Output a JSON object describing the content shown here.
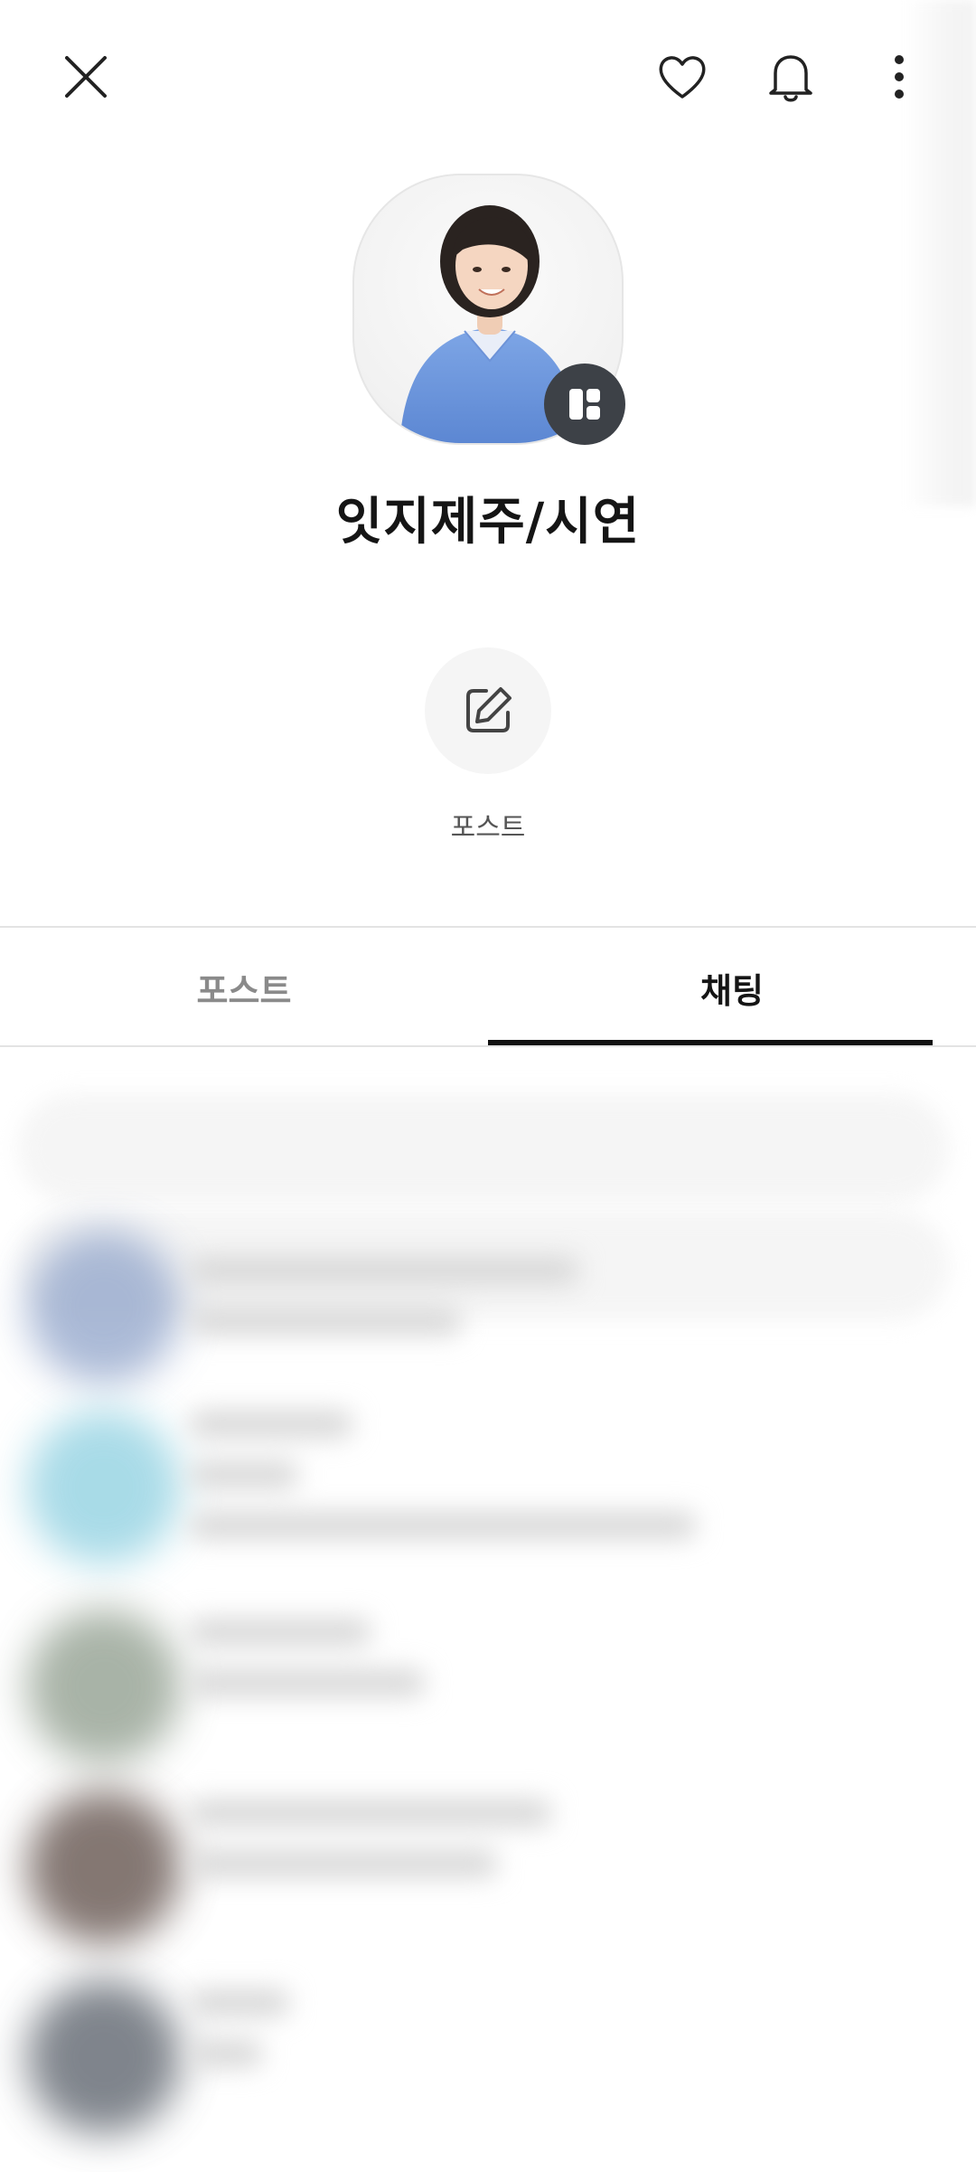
{
  "profile": {
    "name": "잇지제주/시연"
  },
  "actions": {
    "post_label": "포스트"
  },
  "tabs": [
    {
      "label": "포스트",
      "active": false
    },
    {
      "label": "채팅",
      "active": true
    }
  ],
  "icons": {
    "close": "close-icon",
    "favorite": "heart-icon",
    "notifications": "bell-icon",
    "more": "more-vertical-icon",
    "avatar_badge": "profile-card-icon",
    "post": "edit-icon"
  },
  "colors": {
    "badge_bg": "#3d4147",
    "active_tab": "#111111",
    "inactive_tab": "#8a8a8a"
  }
}
